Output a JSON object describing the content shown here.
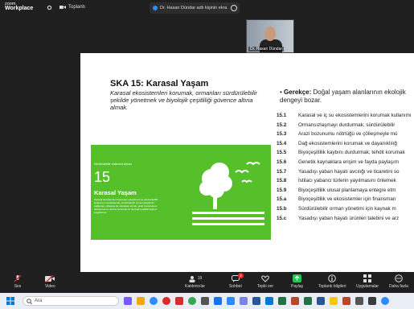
{
  "app": {
    "brand_small": "zoom",
    "brand_name": "Workplace"
  },
  "topbar": {
    "meeting_label": "Toplantı",
    "share_label": "Dr. Hasan Dündar adlı kişinin ekra"
  },
  "video": {
    "participant_name": "Dr. Hasan Dündar"
  },
  "slide": {
    "title": "SKA 15: Karasal Yaşam",
    "subtitle": "Karasal ekosistemleri korumak, ormanları sürdürülebilir şekilde yönetmek ve biyolojik çeşitliliği güvence altına almak.",
    "card": {
      "small": "Sürdürülebilir Kalkınma Amacı",
      "number": "15",
      "title": "Karasal Yaşam",
      "text": "Karasal ekosistemleri korumak, iyileştirmek ve sürdürülebilir kullanımını desteklemek, sürdürülebilir orman yönetimini sağlamak, çölleşme ile mücadele etmek, arazi bozulmasını durdurmak ve tersine çevirmek ve biyolojik çeşitlilik kaybını engellemek"
    },
    "gerekce_label": "Gerekçe:",
    "gerekce_text": "Doğal yaşam alanlarının ekolojik dengeyi bozar.",
    "targets": [
      {
        "num": "15.1",
        "text": "Karasal ve iç su ekosistemlerini korumak kullanımı"
      },
      {
        "num": "15.2",
        "text": "Ormansızlaşmayı durdurmak; sürdürülebilir"
      },
      {
        "num": "15.3",
        "text": "Arazi bozunumu nötrlüğü ve çölleşmeyle mü"
      },
      {
        "num": "15.4",
        "text": "Dağ ekosistemlerini korumak ve dayanıklılığ"
      },
      {
        "num": "15.5",
        "text": "Biyoçeşitlilik kaybını durdurmak; tehdit korumak"
      },
      {
        "num": "15.6",
        "text": "Genetik kaynaklara erişim ve fayda paylaşım"
      },
      {
        "num": "15.7",
        "text": "Yasadışı yaban hayatı avcılığı ve ticaretini so"
      },
      {
        "num": "15.8",
        "text": "İstilacı yabancı türlerin yayılmasını önlemek"
      },
      {
        "num": "15.9",
        "text": "Biyoçeşitlilik ulusal planlamaya entegre etm"
      },
      {
        "num": "15.a",
        "text": "Biyoçeşitlilik ve ekosistemler için finansman"
      },
      {
        "num": "15.b",
        "text": "Sürdürülebilir orman yönetimi için kaynak m"
      },
      {
        "num": "15.c",
        "text": "Yasadışı yaban hayatı ürünleri talebini ve arz"
      }
    ]
  },
  "toolbar": {
    "audio": "Ses",
    "video": "Video",
    "participants": "Katılımcılar",
    "participants_count": "19",
    "chat": "Sohbet",
    "chat_badge": "3",
    "react": "Tepki ver",
    "share": "Paylaş",
    "info": "Toplantı bilgileri",
    "apps": "Uygulamalar",
    "more": "Daha fazla"
  },
  "taskbar": {
    "search_placeholder": "Ara"
  },
  "colors": {
    "green": "#56c02b",
    "zoom_blue": "#2d8cff",
    "muted_red": "#e02828",
    "share_green": "#23c552"
  }
}
